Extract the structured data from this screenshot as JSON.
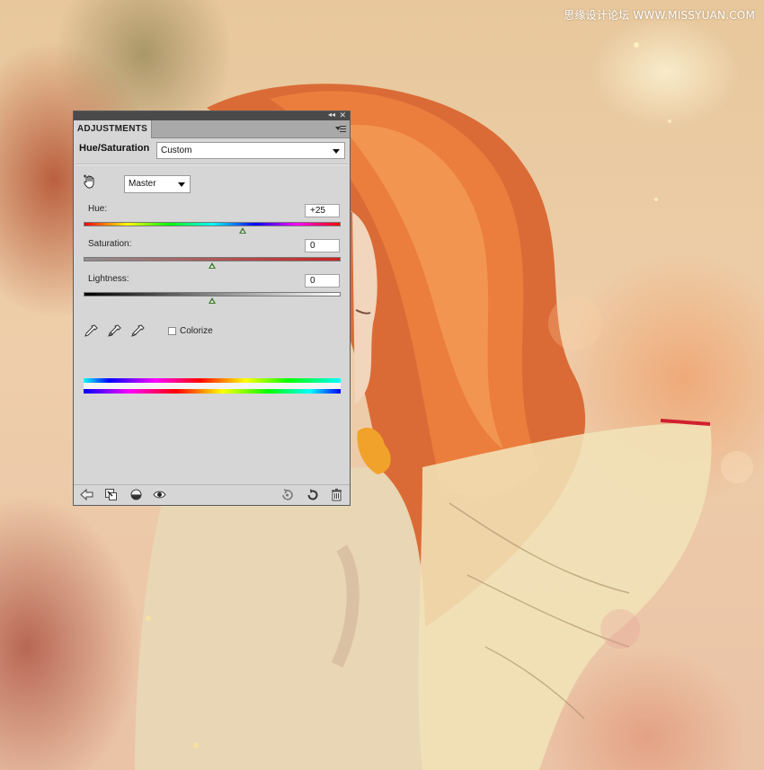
{
  "watermark": "思缘设计论坛 WWW.MISSYUAN.COM",
  "panel": {
    "tab_label": "ADJUSTMENTS",
    "title_collapse": "◂◂",
    "title_close": "✕",
    "adjustment_name": "Hue/Saturation",
    "preset": "Custom",
    "channel": "Master",
    "hue": {
      "label": "Hue:",
      "value": "+25",
      "position": 0.62
    },
    "saturation": {
      "label": "Saturation:",
      "value": "0",
      "position": 0.5
    },
    "lightness": {
      "label": "Lightness:",
      "value": "0",
      "position": 0.5
    },
    "colorize_label": "Colorize",
    "colorize_checked": false,
    "footer_icons": [
      "back-arrow-icon",
      "clip-to-layer-icon",
      "visibility-circle-icon",
      "eye-icon",
      "previous-state-icon",
      "reset-icon",
      "trash-icon"
    ]
  },
  "icons": {
    "hand": "targeted-adjustment-hand-icon",
    "eyedroppers": [
      "eyedropper-icon",
      "eyedropper-plus-icon",
      "eyedropper-minus-icon"
    ]
  }
}
